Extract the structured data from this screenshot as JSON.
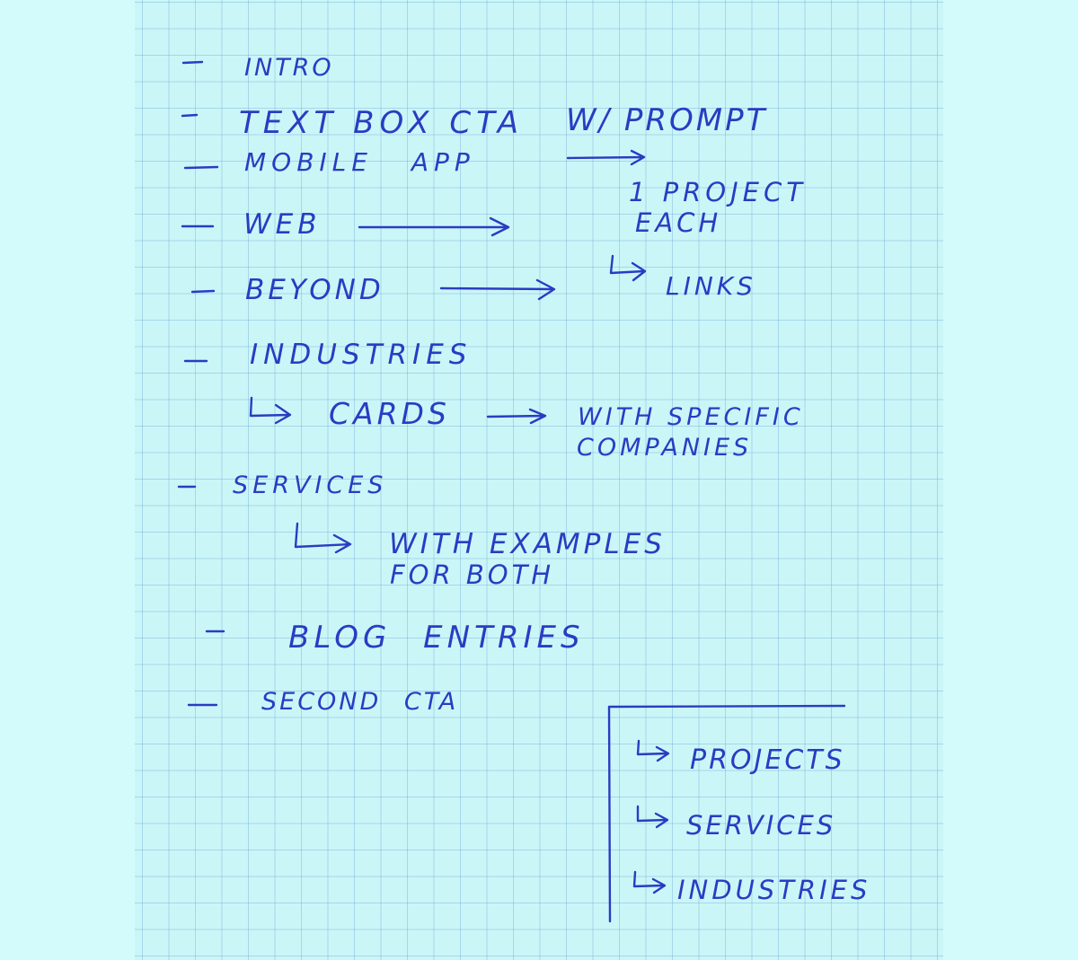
{
  "notes": {
    "intro": "INTRO",
    "text_box_cta": "TEXT BOX CTA",
    "with_prompt": "W/ PROMPT",
    "mobile_app": "MOBILE APP",
    "one_project": "1 PROJECT",
    "each": "EACH",
    "web": "WEB",
    "beyond": "BEYOND",
    "links": "LINKS",
    "industries": "INDUSTRIES",
    "cards": "CARDS",
    "with_specific": "WITH SPECIFIC",
    "companies": "COMPANIES",
    "services": "SERVICES",
    "with_examples": "WITH EXAMPLES",
    "for_both": "FOR BOTH",
    "blog_entries": "BLOG ENTRIES",
    "second_cta": "SECOND CTA",
    "cta_projects": "PROJECTS",
    "cta_services": "SERVICES",
    "cta_industries": "INDUSTRIES"
  },
  "colors": {
    "ink": "#2a3cc2",
    "paper": "#cbf6f8",
    "grid": "#78afd7"
  }
}
